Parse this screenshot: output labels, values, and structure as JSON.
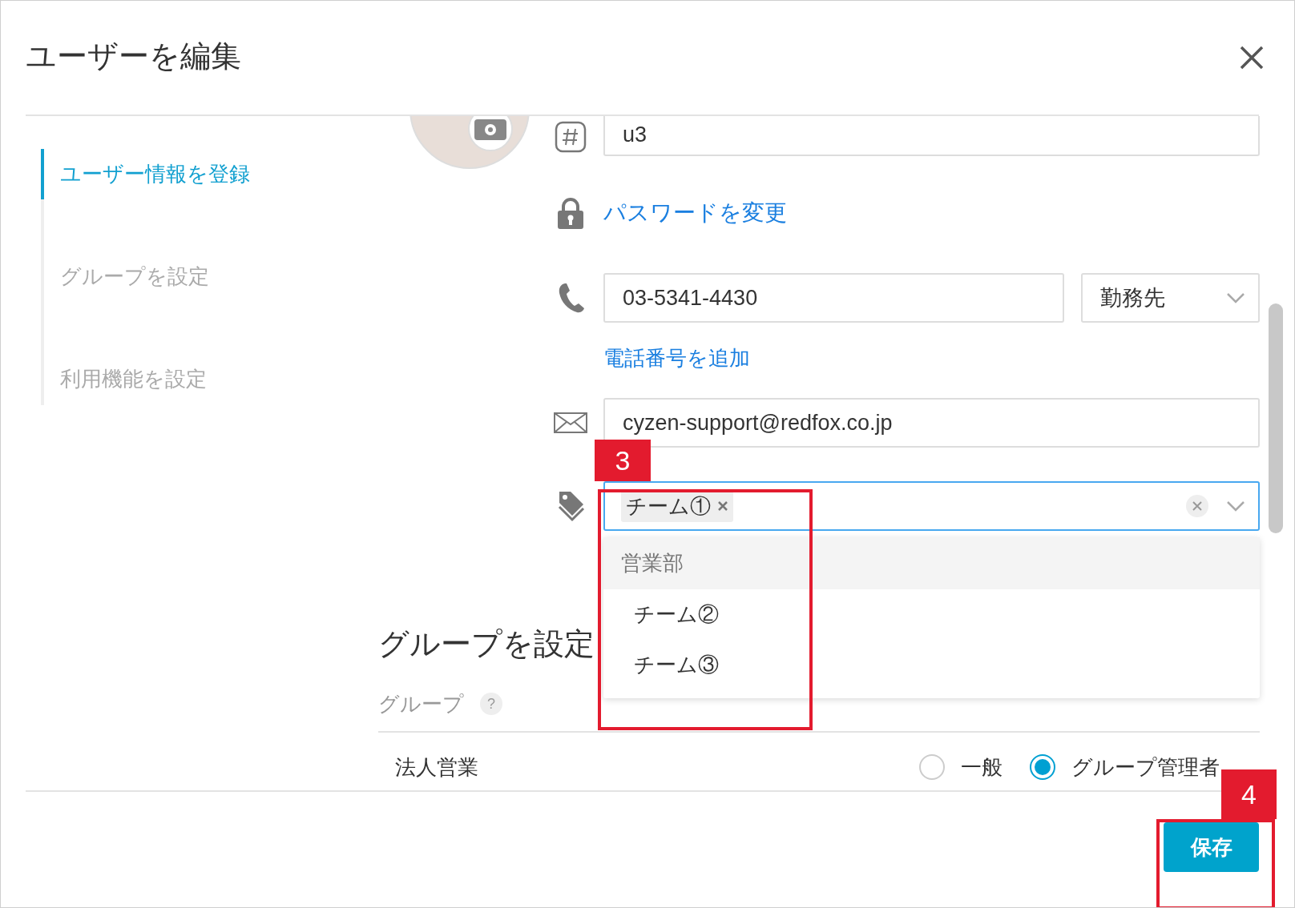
{
  "dialog": {
    "title": "ユーザーを編集"
  },
  "nav": [
    {
      "label": "ユーザー情報を登録",
      "selected": true
    },
    {
      "label": "グループを設定",
      "selected": false
    },
    {
      "label": "利用機能を設定",
      "selected": false
    }
  ],
  "form": {
    "user_id": "u3",
    "password_link": "パスワードを変更",
    "phone": {
      "value": "03-5341-4430",
      "type": "勤務先"
    },
    "add_phone_link": "電話番号を追加",
    "email": "cyzen-support@redfox.co.jp",
    "groups": {
      "chips": [
        {
          "label": "チーム①"
        }
      ],
      "menu": {
        "header": "営業部",
        "items": [
          {
            "label": "チーム②"
          },
          {
            "label": "チーム③"
          }
        ]
      }
    }
  },
  "group_section": {
    "heading": "グループを設定",
    "label": "グループ",
    "help": "?",
    "rows": [
      {
        "name": "法人営業",
        "options": [
          {
            "label": "一般",
            "selected": false
          },
          {
            "label": "グループ管理者",
            "selected": true
          }
        ]
      }
    ]
  },
  "save_button": "保存",
  "annotations": [
    {
      "label": "3"
    },
    {
      "label": "4"
    }
  ]
}
